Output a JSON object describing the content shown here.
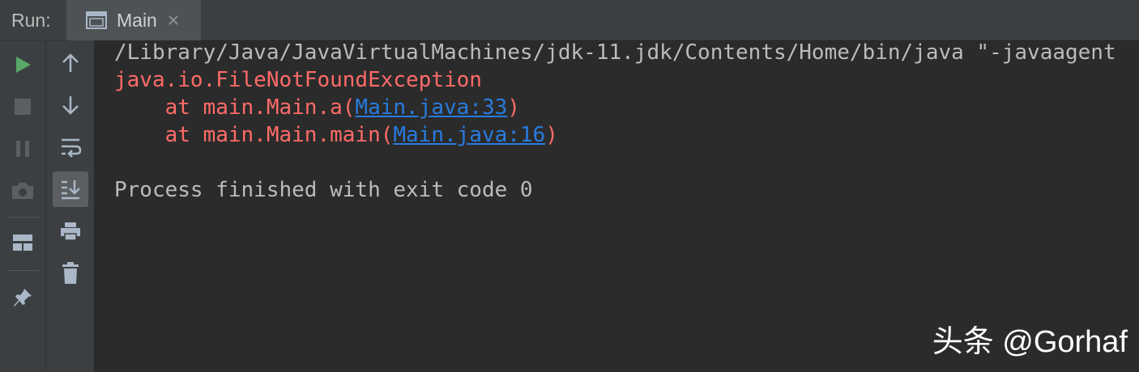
{
  "header": {
    "run_label": "Run:",
    "tab": {
      "label": "Main",
      "icon": "console-window-icon",
      "close_icon": "close-icon"
    }
  },
  "toolbar_left": [
    {
      "name": "rerun",
      "icon": "play-icon",
      "color": "#59a869"
    },
    {
      "name": "stop",
      "icon": "stop-icon"
    },
    {
      "name": "pause",
      "icon": "pause-icon"
    },
    {
      "name": "dump-threads",
      "icon": "camera-icon"
    },
    {
      "name": "restore-layout",
      "icon": "layout-icon"
    },
    {
      "name": "pin-tab",
      "icon": "pin-icon"
    }
  ],
  "toolbar_right": [
    {
      "name": "up-stack-trace",
      "icon": "arrow-up-icon"
    },
    {
      "name": "down-stack-trace",
      "icon": "arrow-down-icon"
    },
    {
      "name": "soft-wrap",
      "icon": "soft-wrap-icon"
    },
    {
      "name": "scroll-to-end",
      "icon": "scroll-to-end-icon",
      "active": true
    },
    {
      "name": "print",
      "icon": "printer-icon"
    },
    {
      "name": "clear-all",
      "icon": "trash-icon"
    }
  ],
  "console": {
    "command": "/Library/Java/JavaVirtualMachines/jdk-11.jdk/Contents/Home/bin/java \"-javaagent",
    "exception": "java.io.FileNotFoundException",
    "stack": [
      {
        "prefix": "    at main.Main.a(",
        "link": "Main.java:33",
        "suffix": ")"
      },
      {
        "prefix": "    at main.Main.main(",
        "link": "Main.java:16",
        "suffix": ")"
      }
    ],
    "exit_message": "Process finished with exit code 0"
  },
  "watermark": "头条 @Gorhaf",
  "colors": {
    "background": "#2b2b2b",
    "toolbar": "#3c3f41",
    "error_text": "#ff6b68",
    "link": "#287bde",
    "normal_text": "#bbbbbb"
  }
}
